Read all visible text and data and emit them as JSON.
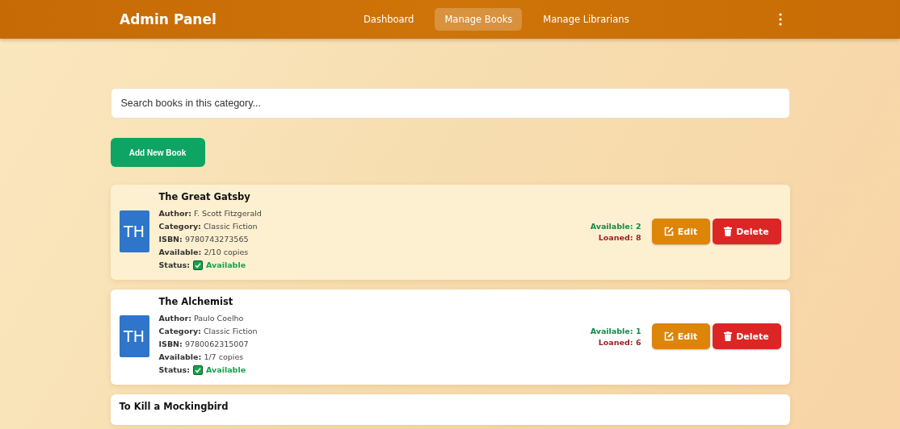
{
  "navbar": {
    "title": "Admin Panel",
    "links": [
      {
        "label": "Dashboard",
        "selected": false
      },
      {
        "label": "Manage Books",
        "selected": true
      },
      {
        "label": "Manage Librarians",
        "selected": false
      }
    ]
  },
  "search": {
    "placeholder": "Search books in this category..."
  },
  "add_button": "Add New Book",
  "books": [
    {
      "title": "The Great Gatsby",
      "initials": "TH",
      "highlighted": true,
      "fields": [
        {
          "label": "Author:",
          "value": "F. Scott Fitzgerald"
        },
        {
          "label": "Category:",
          "value": "Classic Fiction"
        },
        {
          "label": "ISBN:",
          "value": "9780743273565"
        },
        {
          "label": "Available:",
          "value": "2/10 copies"
        }
      ],
      "status_label": "Status:",
      "status": "Available",
      "available": "Available: 2",
      "loaned": "Loaned: 8",
      "edit": "Edit",
      "delete": "Delete"
    },
    {
      "title": "The Alchemist",
      "initials": "TH",
      "highlighted": false,
      "fields": [
        {
          "label": "Author:",
          "value": "Paulo Coelho"
        },
        {
          "label": "Category:",
          "value": "Classic Fiction"
        },
        {
          "label": "ISBN:",
          "value": "9780062315007"
        },
        {
          "label": "Available:",
          "value": "1/7 copies"
        }
      ],
      "status_label": "Status:",
      "status": "Available",
      "available": "Available: 1",
      "loaned": "Loaned: 6",
      "edit": "Edit",
      "delete": "Delete"
    },
    {
      "title": "To Kill a Mockingbird",
      "highlighted": false
    }
  ]
}
